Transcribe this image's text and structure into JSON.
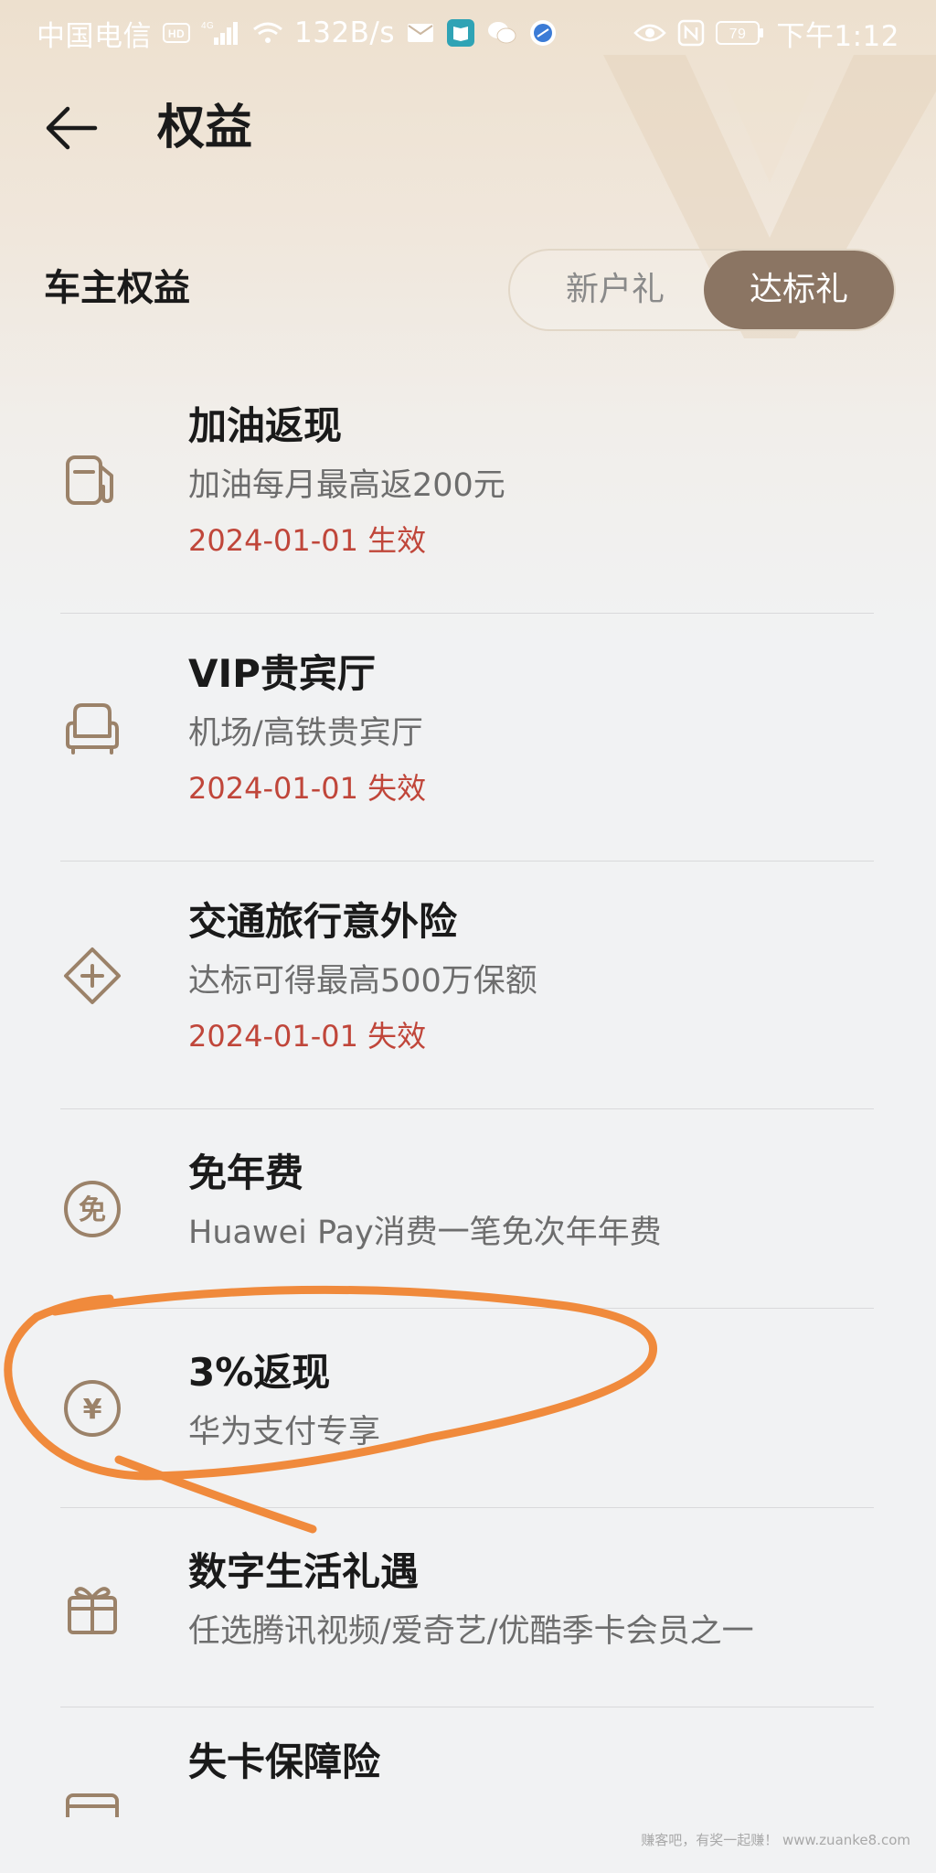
{
  "status_bar": {
    "carrier": "中国电信",
    "network": "4G",
    "speed": "132B/s",
    "battery": "79",
    "time": "下午1:12"
  },
  "header": {
    "back_icon": "arrow-left-icon",
    "title": "权益"
  },
  "section": {
    "title": "车主权益",
    "tabs": [
      {
        "label": "新户礼",
        "selected": false
      },
      {
        "label": "达标礼",
        "selected": true
      }
    ]
  },
  "benefits": [
    {
      "icon": "fuel-pump-icon",
      "title": "加油返现",
      "desc": "加油每月最高返200元",
      "date": "2024-01-01 生效"
    },
    {
      "icon": "armchair-icon",
      "title": "VIP贵宾厅",
      "desc": "机场/高铁贵宾厅",
      "date": "2024-01-01 失效"
    },
    {
      "icon": "insurance-plus-icon",
      "title": "交通旅行意外险",
      "desc": "达标可得最高500万保额",
      "date": "2024-01-01 失效"
    },
    {
      "icon": "waiver-icon",
      "icon_char": "免",
      "title": "免年费",
      "desc": "Huawei Pay消费一笔免次年年费"
    },
    {
      "icon": "yuan-coin-icon",
      "icon_char": "¥",
      "title": "3%返现",
      "desc": "华为支付专享"
    },
    {
      "icon": "gift-icon",
      "title": "数字生活礼遇",
      "desc": "任选腾讯视频/爱奇艺/优酷季卡会员之一"
    },
    {
      "icon": "card-icon",
      "title": "失卡保障险"
    }
  ],
  "colors": {
    "accent": "#8b7563",
    "icon": "#9b8269",
    "date_text": "#c0463a",
    "annotation": "#f08a3c"
  },
  "watermark": "赚客吧，有奖一起赚！ www.zuanke8.com"
}
